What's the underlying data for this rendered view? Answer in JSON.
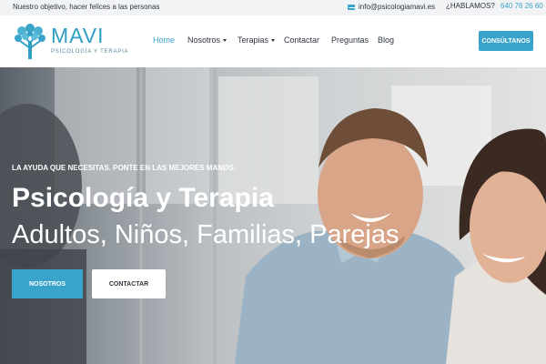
{
  "topbar": {
    "tagline": "Nuestro objetivo, hacer felices a las personas",
    "email": "info@psicologiamavi.es",
    "phone_label": "¿HABLAMOS?",
    "phone_number": "640 76 26 60"
  },
  "logo": {
    "name": "MAVI",
    "subtitle": "PSICOLOGÍA Y TERAPIA"
  },
  "nav": {
    "items": [
      {
        "label": "Home",
        "active": true
      },
      {
        "label": "Nosotros"
      },
      {
        "label": "Terapias"
      },
      {
        "label": "Contactar"
      },
      {
        "label": "Preguntas"
      },
      {
        "label": "Blog"
      }
    ],
    "cta": "CONSÚLTANOS"
  },
  "hero": {
    "kicker": "LA AYUDA QUE NECESITAS. PONTE EN LAS MEJORES MANOS.",
    "title": "Psicología y Terapia",
    "subtitle": "Adultos, Niños, Familias, Parejas",
    "primary_button": "NOSOTROS",
    "secondary_button": "CONTACTAR"
  },
  "colors": {
    "accent": "#3aa3c9",
    "text_dark": "#2f3640"
  }
}
